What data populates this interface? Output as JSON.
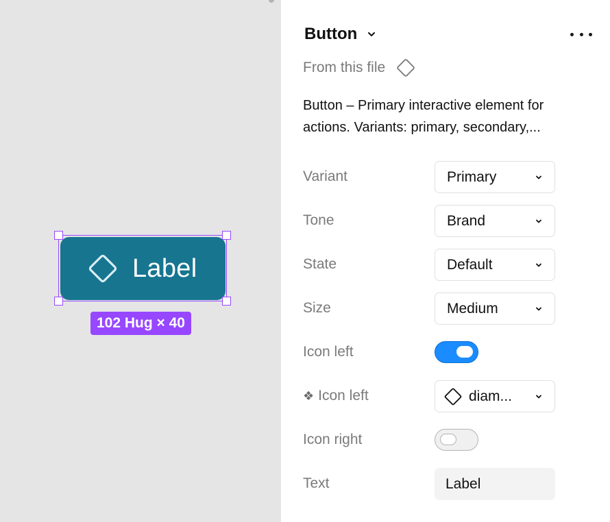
{
  "canvas": {
    "preview_label": "Label",
    "dimensions": "102 Hug × 40",
    "button_color": "#177590",
    "selection_color": "#9747ff"
  },
  "panel": {
    "title": "Button",
    "source": "From this file",
    "description_line1": "Button – Primary interactive element for",
    "description_line2": "actions. Variants: primary, secondary,...",
    "props": {
      "variant": {
        "label": "Variant",
        "value": "Primary"
      },
      "tone": {
        "label": "Tone",
        "value": "Brand"
      },
      "state": {
        "label": "State",
        "value": "Default"
      },
      "size": {
        "label": "Size",
        "value": "Medium"
      },
      "icon_left_toggle": {
        "label": "Icon left",
        "on": true
      },
      "icon_left_swap": {
        "glyph": "❖",
        "label": "Icon left",
        "value": "diam..."
      },
      "icon_right_toggle": {
        "label": "Icon right",
        "on": false
      },
      "text": {
        "label": "Text",
        "value": "Label"
      }
    }
  },
  "icons": {
    "preview": "diamond-icon",
    "title": "chevron-down-icon",
    "more": "more-horizontal-icon",
    "source": "diamond-outline-icon",
    "select_chevron": "chevron-down-icon",
    "swap_instance": "diamond-outline-icon"
  },
  "colors": {
    "toggle_on": "#1a8cff",
    "toggle_off": "#f0f0f0",
    "muted_text": "#7a7a7a"
  }
}
